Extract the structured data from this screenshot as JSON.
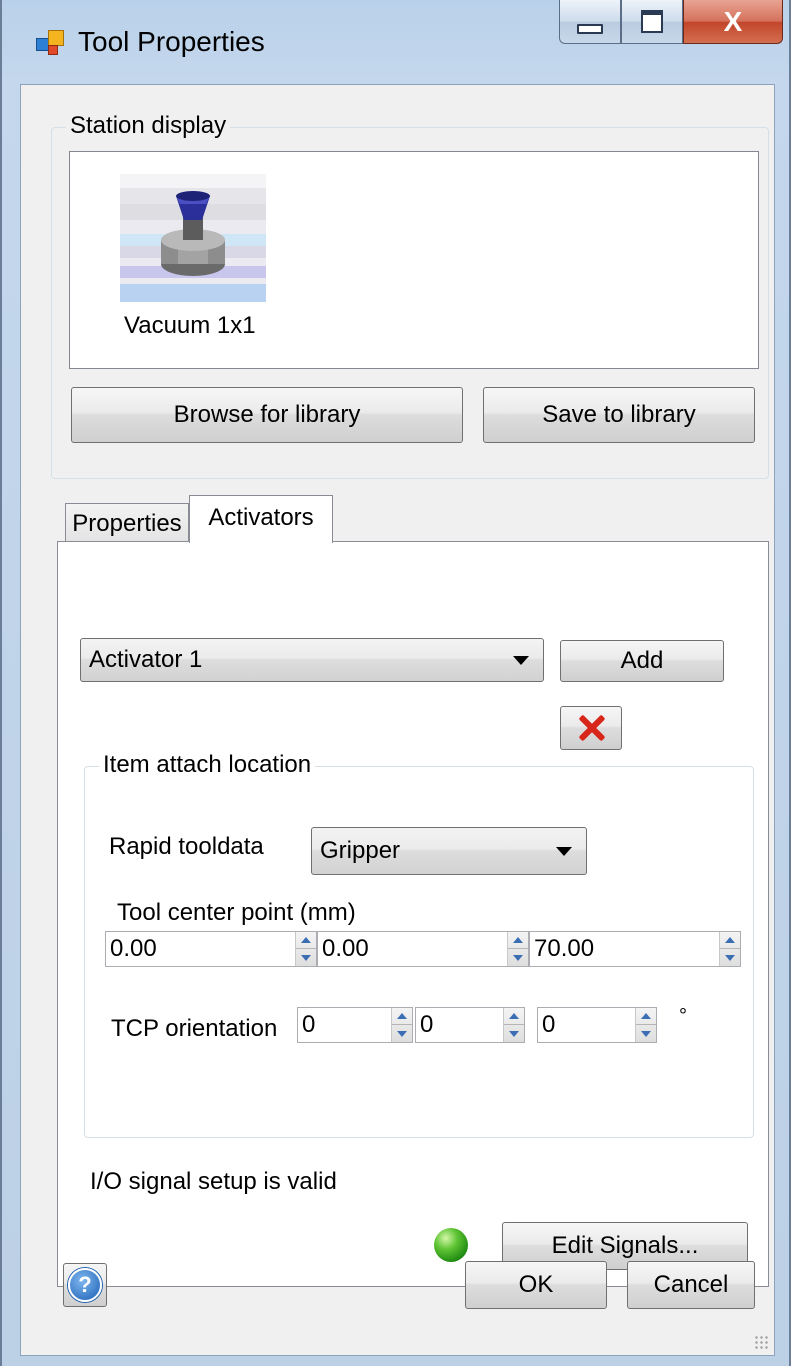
{
  "window": {
    "title": "Tool Properties",
    "close_glyph": "X"
  },
  "station_display": {
    "group_label": "Station display",
    "tool_name": "Vacuum 1x1",
    "browse_button": "Browse for library",
    "save_button": "Save to library"
  },
  "tabs": [
    {
      "label": "Properties",
      "active": false
    },
    {
      "label": "Activators",
      "active": true
    }
  ],
  "activators": {
    "selected_activator": "Activator 1",
    "add_button": "Add",
    "attach_group_label": "Item attach location",
    "rapid_tooldata_label": "Rapid tooldata",
    "rapid_tooldata_value": "Gripper",
    "tcp_label": "Tool center point (mm)",
    "tcp_values": [
      "0.00",
      "0.00",
      "70.00"
    ],
    "tcp_orientation_label": "TCP orientation",
    "tcp_orientation_values": [
      "0",
      "0",
      "0"
    ],
    "degree_symbol": "°",
    "signal_status": "I/O signal setup is valid",
    "edit_signals_button": "Edit Signals..."
  },
  "footer": {
    "help_icon": "?",
    "ok_button": "OK",
    "cancel_button": "Cancel"
  },
  "colors": {
    "status_led": "#3fae1e",
    "delete_icon": "#d8261a",
    "tool_tip": "#2b2f9a"
  }
}
